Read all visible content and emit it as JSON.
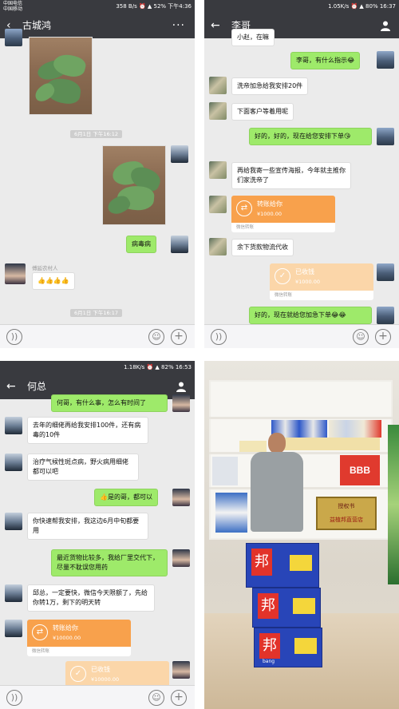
{
  "screen1": {
    "status_left": [
      "中国电信",
      "中国移动"
    ],
    "status_right": "358 B/s ⏰ ▲ 52% 下午4:36",
    "back_icon": "arrow-left-icon",
    "title": "古城鸿",
    "more": "···",
    "time1": "6月1日 下午16:12",
    "msg_out": "病毒病",
    "nickname": "傅延农村人",
    "msg_in": "👍👍👍👍",
    "time2": "6月1日 下午16:17"
  },
  "screen2": {
    "status_right": "1.05K/s ⏰ ▲ 80% 16:37",
    "title": "李哥",
    "messages": [
      {
        "dir": "in",
        "text": "小赵，在嘛"
      },
      {
        "dir": "out",
        "text": "李哥，有什么指示😂"
      },
      {
        "dir": "in",
        "text": "洗帝加急给我安排20件"
      },
      {
        "dir": "in",
        "text": "下面客户等着用呢"
      },
      {
        "dir": "out",
        "text": "好的，好的，现在给您安排下单😘"
      },
      {
        "dir": "in",
        "text": "再给我寄一些宣传海报，今年就主推你们家洗帝了"
      },
      {
        "dir": "in",
        "text": "余下货款物流代收"
      },
      {
        "dir": "out",
        "text": "好的，现在就给您加急下单😂😂"
      }
    ],
    "transfer_in": {
      "label": "转账给你",
      "amount": "¥1000.00",
      "foot": "微信转账"
    },
    "transfer_out": {
      "label": "已收钱",
      "amount": "¥1000.00",
      "foot": "微信转账"
    }
  },
  "screen3": {
    "status_right": "1.18K/s ⏰ ▲ 82% 16:53",
    "title": "何总",
    "messages": [
      {
        "dir": "out",
        "text": "何哥，有什么事，怎么有时间了"
      },
      {
        "dir": "in",
        "text": "去年的细佬再给我安排100件，还有病毒的10件"
      },
      {
        "dir": "in",
        "text": "治疗气候性斑点病，野火病用细佬都可以吧"
      },
      {
        "dir": "out",
        "text": "👍是的哥，都可以"
      },
      {
        "dir": "in",
        "text": "你快速帮我安排，我这边6月中旬都要用"
      },
      {
        "dir": "out",
        "text": "最近货物比较多，我给厂里交代下，尽量不耽误您用药"
      },
      {
        "dir": "in",
        "text": "邱总，一定要快，微信今天限额了，先给你转1万，剩下的明天转"
      }
    ],
    "transfer_in": {
      "label": "转账给你",
      "amount": "¥10000.00",
      "foot": "微信转账"
    },
    "transfer_out": {
      "label": "已收钱",
      "amount": "¥10000.00"
    }
  },
  "screen4": {
    "box_brand": "邦",
    "box_sub": "bang",
    "shelf_labels": [
      "BBB"
    ],
    "certificate_title": "授权书",
    "certificate_store": "益植邦直营店"
  },
  "colors": {
    "bar": "#393a3f",
    "chat_bg": "#ebebeb",
    "outgoing": "#9eea6a",
    "transfer": "#f8a14c",
    "received": "#fbd6a9"
  },
  "icons": {
    "voice": "voice-icon",
    "emoji": "emoji-icon",
    "plus": "plus-icon",
    "person": "person-icon"
  }
}
